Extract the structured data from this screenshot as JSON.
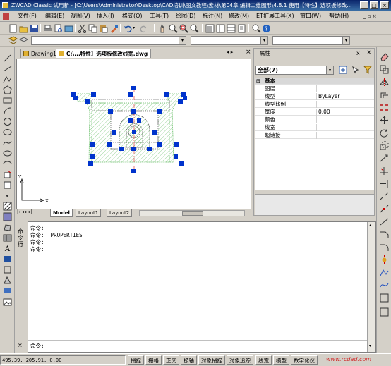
{
  "window": {
    "title": "ZWCAD Classic 试用新 - [C:\\Users\\Administrator\\Desktop\\CAD培训\\图文教程\\素材\\第04章 编辑二维图形\\4.8.1  使用【特性】选项板修改...",
    "minimize": "_",
    "maximize": "□",
    "close": "×"
  },
  "menu": [
    "文件(F)",
    "编辑(E)",
    "视图(V)",
    "插入(I)",
    "格式(O)",
    "工具(T)",
    "绘图(D)",
    "标注(N)",
    "修改(M)",
    "ET扩展工具(X)",
    "窗口(W)",
    "帮助(H)"
  ],
  "doc_tabs": [
    {
      "label": "Drawing1",
      "active": false
    },
    {
      "label": "C:\\...特性】选项板修改线宽.dwg",
      "active": true
    }
  ],
  "layout_tabs": [
    "Model",
    "Layout1",
    "Layout2"
  ],
  "axis": {
    "y": "Y",
    "x": "X"
  },
  "properties": {
    "title": "属性",
    "selection": "全部(7)",
    "section": "基本",
    "rows": [
      {
        "key": "图层",
        "value": ""
      },
      {
        "key": "线型",
        "value": "ByLayer"
      },
      {
        "key": "线型比例",
        "value": ""
      },
      {
        "key": "厚度",
        "value": "0.00"
      },
      {
        "key": "颜色",
        "value": ""
      },
      {
        "key": "线宽",
        "value": ""
      },
      {
        "key": "超链接",
        "value": ""
      }
    ]
  },
  "command": {
    "side_label": "命令行",
    "lines": [
      "命令:",
      "命令: _PROPERTIES",
      "命令:",
      "命令:"
    ],
    "prompt": "命令:"
  },
  "status": {
    "coords": "495.39, 205.91, 0.00",
    "buttons": [
      "捕捉",
      "栅格",
      "正交",
      "极轴",
      "对象捕捉",
      "对象追踪",
      "线宽",
      "模型",
      "数字化仪"
    ],
    "watermark": "www.rcdad.com"
  },
  "colors": {
    "grip": "#0033cc",
    "hatch": "#6abf6a",
    "centerline": "#e04040",
    "title_bar": "#0a246a"
  }
}
